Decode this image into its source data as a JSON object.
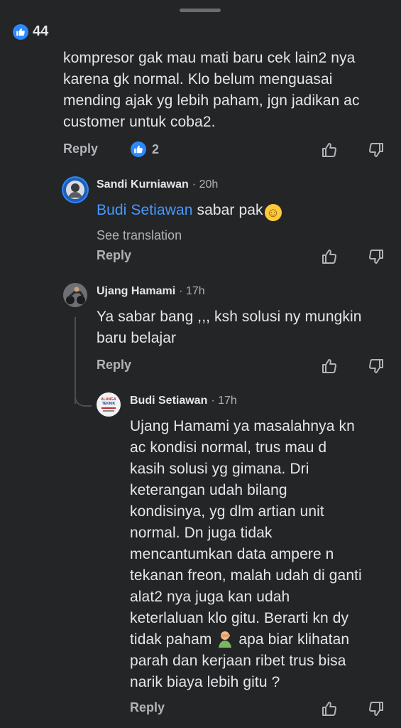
{
  "top_comment": {
    "reaction_count": "44",
    "text_lines": [
      "kompresor gak mau mati baru cek lain2 nya",
      "karena gk normal. Klo belum menguasai",
      "mending ajak yg lebih paham, jgn jadikan ac",
      "customer untuk coba2."
    ],
    "reply_label": "Reply",
    "like_count": "2"
  },
  "replies": [
    {
      "author": "Sandi Kurniawan",
      "time": "· 20h",
      "mention": "Budi Setiawan",
      "text": " sabar pak",
      "emoji": "☺",
      "see_translation": "See translation",
      "reply_label": "Reply"
    },
    {
      "author": "Ujang Hamami",
      "time": "· 17h",
      "text_lines": [
        "Ya sabar bang ,,, ksh solusi ny mungkin",
        "baru belajar"
      ],
      "reply_label": "Reply"
    },
    {
      "author": "Budi Setiawan",
      "time": "· 17h",
      "text_lines": [
        "Ujang Hamami ya masalahnya kn",
        "ac kondisi normal, trus mau d",
        "kasih solusi yg gimana. Dri",
        "keterangan udah bilang",
        "kondisinya, yg dlm artian unit",
        "normal. Dn juga tidak",
        "mencantumkan data ampere n",
        "tekanan freon, malah udah di ganti",
        "alat2 nya juga kan udah",
        "keterlaluan klo gitu. Berarti kn dy"
      ],
      "line11_before": "tidak paham ",
      "line11_after": " apa biar klihatan",
      "tail_lines": [
        "parah dan kerjaan ribet trus bisa",
        "narik biaya lebih gitu ?"
      ],
      "reply_label": "Reply",
      "avatar_text_1": "ALANGA",
      "avatar_text_2": "TEKNIK"
    }
  ],
  "colors": {
    "background": "#242526",
    "text": "#e4e6eb",
    "muted": "#b0b3b8",
    "mention": "#4599ff",
    "like_badge": "#2d88ff"
  }
}
